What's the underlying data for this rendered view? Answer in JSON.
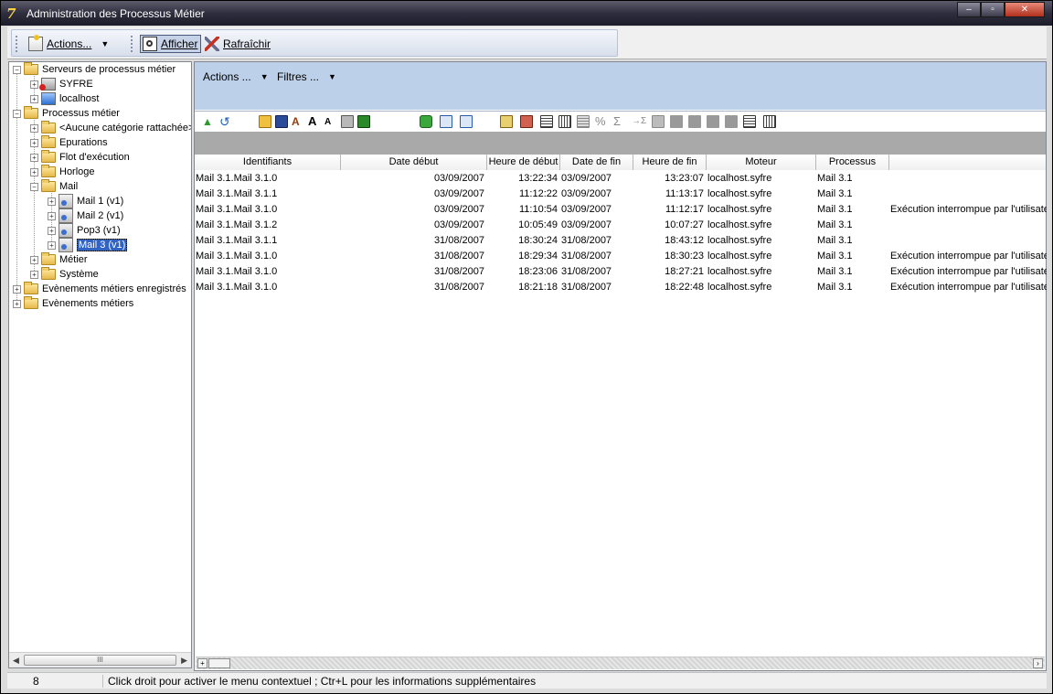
{
  "window": {
    "title": "Administration des Processus Métier",
    "minimize": "–",
    "maximize": "▫",
    "close": "✕"
  },
  "toolbar": {
    "actions_label": "Actions...",
    "afficher_label": "Afficher",
    "rafraichir_label": "Rafraîchir"
  },
  "tree": {
    "servers": "Serveurs de processus métier",
    "syfre": "SYFRE",
    "localhost": "localhost",
    "processus": "Processus métier",
    "aucune": "<Aucune catégorie rattachée>",
    "epurations": "Epurations",
    "flot": "Flot d'exécution",
    "horloge": "Horloge",
    "mail": "Mail",
    "mail1": "Mail 1 (v1)",
    "mail2": "Mail 2 (v1)",
    "pop3": "Pop3 (v1)",
    "mail3": "Mail 3 (v1)",
    "metier": "Métier",
    "systeme": "Système",
    "evt_enregistres": "Evènements métiers enregistrés",
    "evt_metiers": "Evènements métiers",
    "scroll_thumb": "III"
  },
  "filters": {
    "actions": "Actions ...",
    "filtres": "Filtres ..."
  },
  "grid": {
    "columns": [
      "Identifiants",
      "Date début",
      "Heure de début",
      "Date de fin",
      "Heure de fin",
      "Moteur",
      "Processus",
      ""
    ],
    "rows": [
      [
        "Mail 3.1.Mail 3.1.0",
        "03/09/2007",
        "13:22:34",
        "03/09/2007",
        "13:23:07",
        "localhost.syfre",
        "Mail 3.1",
        ""
      ],
      [
        "Mail 3.1.Mail 3.1.1",
        "03/09/2007",
        "11:12:22",
        "03/09/2007",
        "11:13:17",
        "localhost.syfre",
        "Mail 3.1",
        ""
      ],
      [
        "Mail 3.1.Mail 3.1.0",
        "03/09/2007",
        "11:10:54",
        "03/09/2007",
        "11:12:17",
        "localhost.syfre",
        "Mail 3.1",
        "Exécution interrompue par l'utilisateur"
      ],
      [
        "Mail 3.1.Mail 3.1.2",
        "03/09/2007",
        "10:05:49",
        "03/09/2007",
        "10:07:27",
        "localhost.syfre",
        "Mail 3.1",
        ""
      ],
      [
        "Mail 3.1.Mail 3.1.1",
        "31/08/2007",
        "18:30:24",
        "31/08/2007",
        "18:43:12",
        "localhost.syfre",
        "Mail 3.1",
        ""
      ],
      [
        "Mail 3.1.Mail 3.1.0",
        "31/08/2007",
        "18:29:34",
        "31/08/2007",
        "18:30:23",
        "localhost.syfre",
        "Mail 3.1",
        "Exécution interrompue par l'utilisateur"
      ],
      [
        "Mail 3.1.Mail 3.1.0",
        "31/08/2007",
        "18:23:06",
        "31/08/2007",
        "18:27:21",
        "localhost.syfre",
        "Mail 3.1",
        "Exécution interrompue par l'utilisateur"
      ],
      [
        "Mail 3.1.Mail 3.1.0",
        "31/08/2007",
        "18:21:18",
        "31/08/2007",
        "18:22:48",
        "localhost.syfre",
        "Mail 3.1",
        "Exécution interrompue par l'utilisateur"
      ]
    ]
  },
  "status": {
    "count": "8",
    "message": "Click droit pour activer le menu contextuel ; Ctr+L pour les informations supplémentaires"
  }
}
